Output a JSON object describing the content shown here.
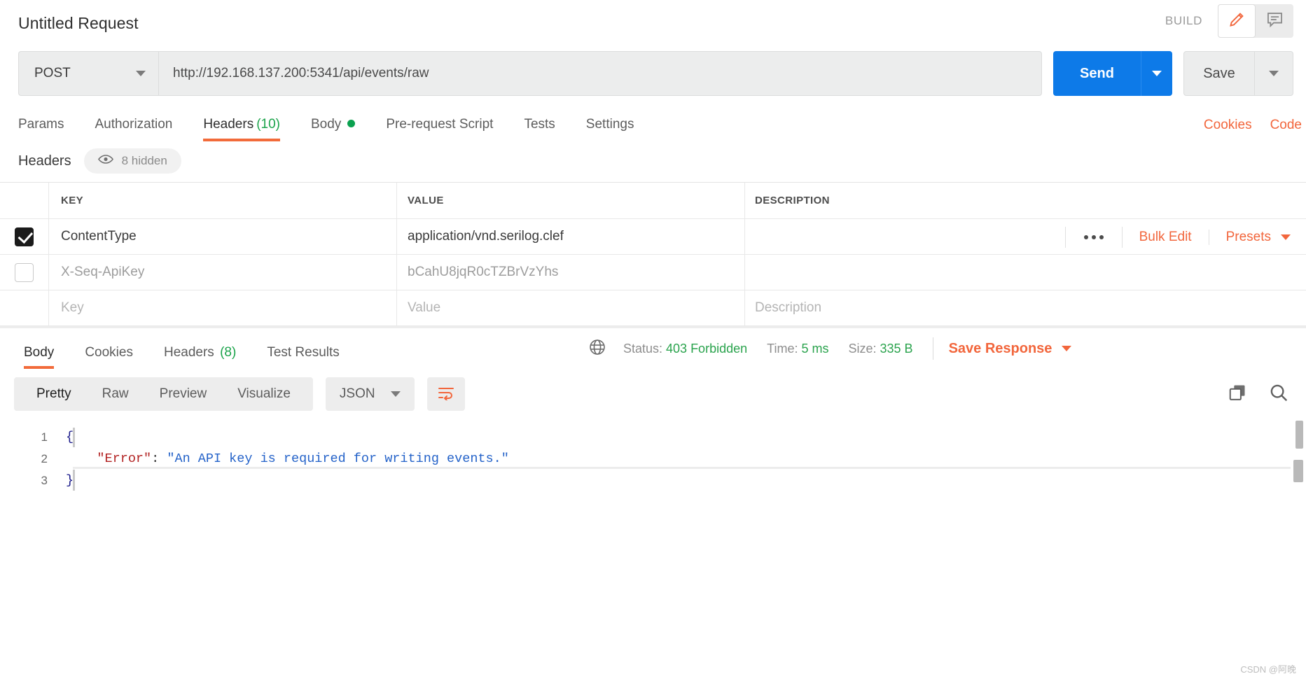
{
  "header": {
    "request_title": "Untitled Request",
    "build_label": "BUILD",
    "edit_icon": "pencil-icon",
    "comment_icon": "comment-icon"
  },
  "urlbar": {
    "method": "POST",
    "url": "http://192.168.137.200:5341/api/events/raw",
    "send_label": "Send",
    "save_label": "Save"
  },
  "request_tabs": {
    "items": [
      {
        "label": "Params",
        "active": false
      },
      {
        "label": "Authorization",
        "active": false
      },
      {
        "label": "Headers",
        "count": "(10)",
        "active": true
      },
      {
        "label": "Body",
        "dot": true,
        "active": false
      },
      {
        "label": "Pre-request Script",
        "active": false
      },
      {
        "label": "Tests",
        "active": false
      },
      {
        "label": "Settings",
        "active": false
      }
    ],
    "cookies_link": "Cookies",
    "code_link": "Code"
  },
  "headers_panel": {
    "title": "Headers",
    "hidden_pill": "8 hidden",
    "eye_icon": "eye-icon",
    "columns": {
      "key": "KEY",
      "value": "VALUE",
      "description": "DESCRIPTION"
    },
    "actions": {
      "more_icon": "ellipsis-icon",
      "bulk_edit": "Bulk Edit",
      "presets": "Presets"
    },
    "rows": [
      {
        "checked": true,
        "enabled": true,
        "key": "ContentType",
        "value": "application/vnd.serilog.clef",
        "description": ""
      },
      {
        "checked": false,
        "enabled": false,
        "key": "X-Seq-ApiKey",
        "value": "bCahU8jqR0cTZBrVzYhs",
        "description": ""
      }
    ],
    "new_row": {
      "key_placeholder": "Key",
      "value_placeholder": "Value",
      "description_placeholder": "Description"
    }
  },
  "response": {
    "tabs": [
      {
        "label": "Body",
        "active": true
      },
      {
        "label": "Cookies",
        "active": false
      },
      {
        "label": "Headers",
        "count": "(8)",
        "active": false
      },
      {
        "label": "Test Results",
        "active": false
      }
    ],
    "globe_icon": "globe-icon",
    "status_label": "Status:",
    "status_value": "403 Forbidden",
    "time_label": "Time:",
    "time_value": "5 ms",
    "size_label": "Size:",
    "size_value": "335 B",
    "save_response": "Save Response",
    "view_modes": [
      {
        "label": "Pretty",
        "active": true
      },
      {
        "label": "Raw",
        "active": false
      },
      {
        "label": "Preview",
        "active": false
      },
      {
        "label": "Visualize",
        "active": false
      }
    ],
    "format": "JSON",
    "wrap_icon": "wrap-lines-icon",
    "copy_icon": "copy-icon",
    "search_icon": "search-icon",
    "body_lines": [
      {
        "num": "1",
        "tokens": [
          {
            "t": "brace",
            "s": "{"
          }
        ]
      },
      {
        "num": "2",
        "tokens": [
          {
            "t": "plain",
            "s": "    "
          },
          {
            "t": "key",
            "s": "\"Error\""
          },
          {
            "t": "punc",
            "s": ": "
          },
          {
            "t": "str",
            "s": "\"An API key is required for writing events.\""
          }
        ]
      },
      {
        "num": "3",
        "tokens": [
          {
            "t": "brace",
            "s": "}"
          }
        ]
      }
    ]
  },
  "watermark": "CSDN @阿晚",
  "colors": {
    "accent_orange": "#f26b3a",
    "send_blue": "#0d7ae8",
    "status_green": "#2aa34d",
    "count_green": "#1aa34a"
  }
}
